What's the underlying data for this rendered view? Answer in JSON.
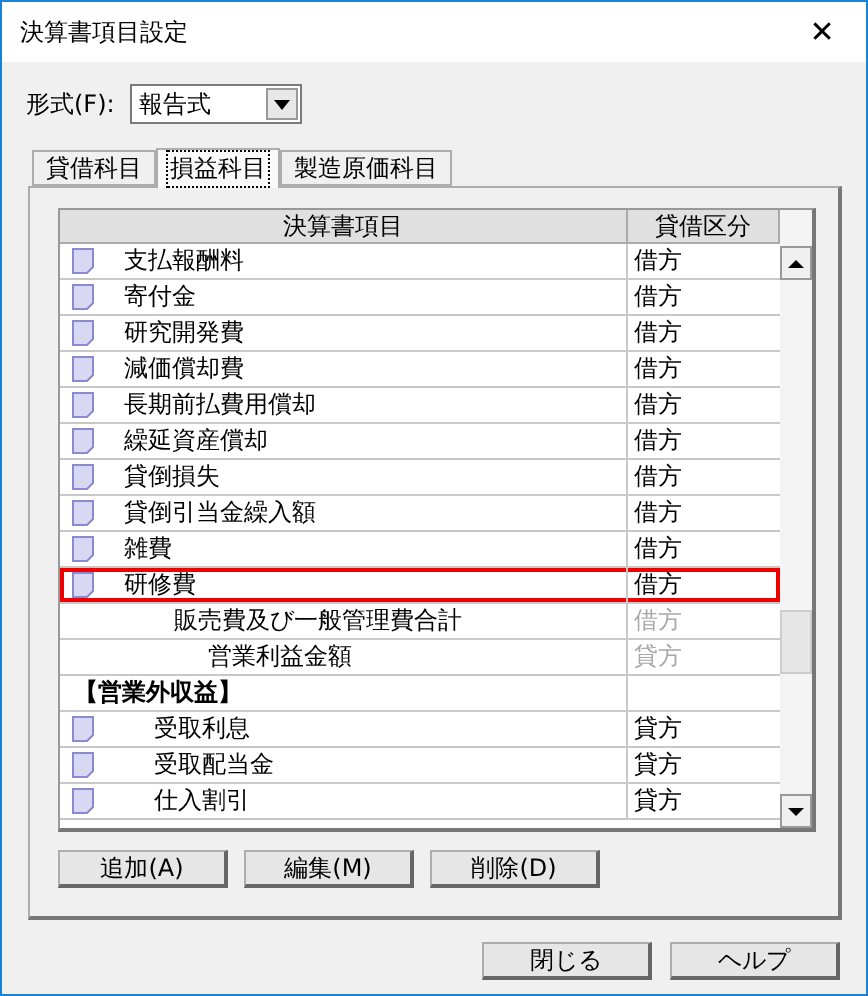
{
  "window": {
    "title": "決算書項目設定",
    "close": "✕"
  },
  "format": {
    "label": "形式(F):",
    "value": "報告式"
  },
  "tabs": [
    {
      "label": "貸借科目",
      "selected": false
    },
    {
      "label": "損益科目",
      "selected": true
    },
    {
      "label": "製造原価科目",
      "selected": false
    }
  ],
  "table": {
    "columns": [
      "決算書項目",
      "貸借区分"
    ],
    "rows": [
      {
        "kind": "account",
        "name": "支払報酬料",
        "side": "借方",
        "selected": false
      },
      {
        "kind": "account",
        "name": "寄付金",
        "side": "借方",
        "selected": false
      },
      {
        "kind": "account",
        "name": "研究開発費",
        "side": "借方",
        "selected": false
      },
      {
        "kind": "account",
        "name": "減価償却費",
        "side": "借方",
        "selected": false
      },
      {
        "kind": "account",
        "name": "長期前払費用償却",
        "side": "借方",
        "selected": false
      },
      {
        "kind": "account",
        "name": "繰延資産償却",
        "side": "借方",
        "selected": false
      },
      {
        "kind": "account",
        "name": "貸倒損失",
        "side": "借方",
        "selected": false
      },
      {
        "kind": "account",
        "name": "貸倒引当金繰入額",
        "side": "借方",
        "selected": false
      },
      {
        "kind": "account",
        "name": "雑費",
        "side": "借方",
        "selected": false
      },
      {
        "kind": "account",
        "name": "研修費",
        "side": "借方",
        "selected": true
      },
      {
        "kind": "total",
        "name": "販売費及び一般管理費合計",
        "side": "借方",
        "selected": false
      },
      {
        "kind": "grand_total",
        "name": "営業利益金額",
        "side": "貸方",
        "selected": false
      },
      {
        "kind": "section",
        "name": "【営業外収益】",
        "selected": false,
        "children": [
          {
            "kind": "account",
            "name": "受取利息",
            "side": "貸方",
            "selected": false
          },
          {
            "kind": "account",
            "name": "受取配当金",
            "side": "貸方",
            "selected": false
          },
          {
            "kind": "account",
            "name": "仕入割引",
            "side": "貸方",
            "selected": false
          }
        ]
      }
    ]
  },
  "actions": [
    "追加(A)",
    "編集(M)",
    "削除(D)"
  ],
  "buttons": [
    "閉じる",
    "ヘルプ"
  ]
}
